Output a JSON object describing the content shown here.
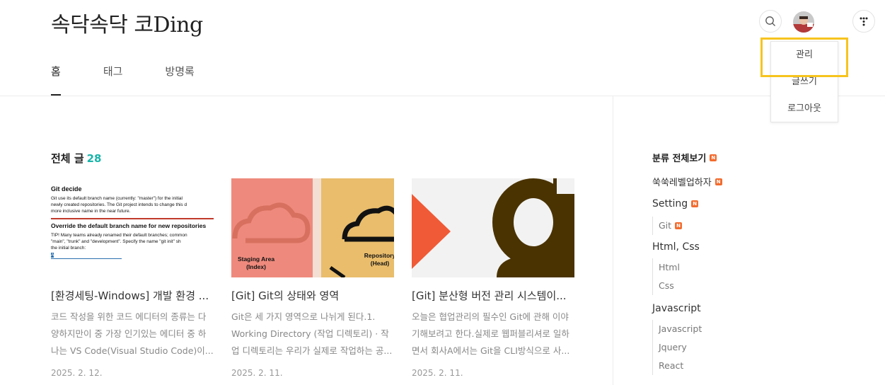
{
  "header": {
    "blog_title": "속닥속닥 코Ding",
    "search_icon": "search-icon",
    "avatar_icon": "avatar",
    "menu_icon": "kebab-dots-icon"
  },
  "nav": {
    "items": [
      {
        "label": "홈",
        "active": true
      },
      {
        "label": "태그",
        "active": false
      },
      {
        "label": "방명록",
        "active": false
      }
    ]
  },
  "dropdown": {
    "items": [
      {
        "label": "관리"
      },
      {
        "label": "글쓰기"
      },
      {
        "label": "로그아웃"
      }
    ],
    "highlight_color": "#f7c41e"
  },
  "posts": {
    "heading": "전체 글",
    "count": "28",
    "items": [
      {
        "title": "[환경세팅-Windows] 개발 환경 ...",
        "excerpt": "코드 작성을 위한 코드 에디터의 종류는 다양하지만이 중 가장 인기있는 에디터 중 하나는 VS Code(Visual Studio Code)이...",
        "date": "2025. 2. 12.",
        "thumb": {
          "heading1": "Git decide",
          "text1": "Git use its default branch name (currently: \"master\") for the initial",
          "text2": "newly created repositories. The Git project intends to change this d",
          "text3": "more inclusive name in the near future.",
          "heading2": "Override the default branch name for new repositories",
          "text4": "TIP! Many teams already renamed their default branches; common",
          "text5": "\"main\", \"trunk\" and \"development\". Specify the name \"git init\" sh",
          "text6": "the initial branch:",
          "input": "A"
        }
      },
      {
        "title": "[Git] Git의 상태와 영역",
        "excerpt": "Git은 세 가지 영역으로 나뉘게 된다.1. Working Directory (작업 디렉토리) · 작업 디렉토리는 우리가 실제로 작업하는 공...",
        "date": "2025. 2. 11.",
        "thumb": {
          "left_label_1": "Staging Area",
          "left_label_2": "(Index)",
          "right_label_1": "Repository",
          "right_label_2": "(Head)"
        }
      },
      {
        "title": "[Git] 분산형 버전 관리 시스템이...",
        "excerpt": "오늘은 협업관리의 필수인 Git에 관해 이야기해보려고 한다.실제로 웹퍼블리셔로 일하면서 회사A에서는 Git을 CLI방식으로 사...",
        "date": "2025. 2. 11.",
        "thumb": {}
      }
    ]
  },
  "sidebar": {
    "all_label": "분류 전체보기",
    "badge": "N",
    "categories": [
      {
        "label": "쑥쑥레벨업하자",
        "new": true
      },
      {
        "label": "Setting",
        "new": true
      },
      {
        "label": "Html, Css",
        "new": false
      },
      {
        "label": "Javascript",
        "new": false
      }
    ],
    "subs": {
      "setting": [
        {
          "label": "Git",
          "new": true
        }
      ],
      "html_css": [
        {
          "label": "Html"
        },
        {
          "label": "Css"
        }
      ],
      "javascript": [
        {
          "label": "Javascript"
        },
        {
          "label": "Jquery"
        },
        {
          "label": "React"
        }
      ]
    }
  },
  "colors": {
    "accent_count": "#19b4aa",
    "new_badge": "#f26c2f",
    "thumb2_left": "#ee8a7d",
    "thumb2_right": "#e9bd6c",
    "thumb3_orange": "#f05a36",
    "thumb3_brown": "#4a3300"
  }
}
